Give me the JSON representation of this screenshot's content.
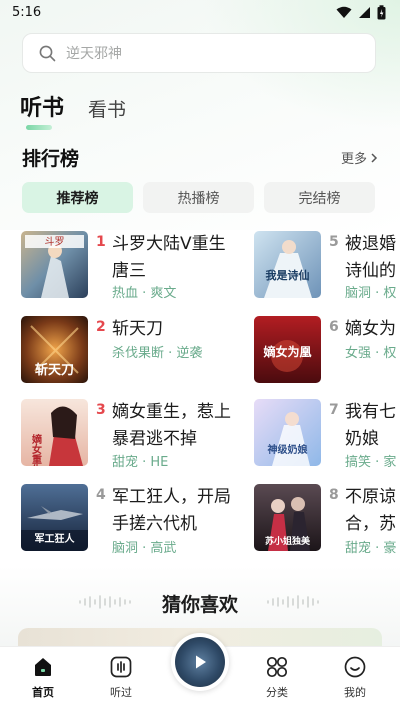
{
  "status_bar": {
    "time": "5:16"
  },
  "search": {
    "placeholder": "逆天邪神"
  },
  "top_tabs": [
    {
      "label": "听书",
      "active": true
    },
    {
      "label": "看书",
      "active": false
    }
  ],
  "ranking": {
    "title": "排行榜",
    "more_label": "更多",
    "tabs": [
      {
        "label": "推荐榜",
        "active": true
      },
      {
        "label": "热播榜",
        "active": false
      },
      {
        "label": "完结榜",
        "active": false
      }
    ],
    "books": [
      {
        "rank": "1",
        "title": "斗罗大陆V重生唐三",
        "tags": "热血 · 爽文",
        "cover_text": "斗罗"
      },
      {
        "rank": "2",
        "title": "斩天刀",
        "tags": "杀伐果断 · 逆袭",
        "cover_text": "斩天刀"
      },
      {
        "rank": "3",
        "title": "嫡女重生，惹上暴君逃不掉",
        "tags": "甜宠 · HE",
        "cover_text": "嫡女重生"
      },
      {
        "rank": "4",
        "title": "军工狂人，开局手搓六代机",
        "tags": "脑洞 · 高武",
        "cover_text": "军工狂人"
      },
      {
        "rank": "5",
        "title": "被退婚",
        "title_line2": "诗仙的",
        "tags": "脑洞 · 权",
        "cover_text": "我是诗仙"
      },
      {
        "rank": "6",
        "title": "嫡女为",
        "tags": "女强 · 权",
        "cover_text": "嫡女为凰"
      },
      {
        "rank": "7",
        "title": "我有七",
        "title_line2": "奶娘",
        "tags": "搞笑 · 家",
        "cover_text": "神级奶娘"
      },
      {
        "rank": "8",
        "title": "不原谅",
        "title_line2": "合，苏",
        "tags": "甜宠 · 豪",
        "cover_text": "苏小姐独美"
      }
    ]
  },
  "guess": {
    "title": "猜你喜欢"
  },
  "bottom_nav": [
    {
      "label": "首页",
      "icon": "home-icon",
      "active": true
    },
    {
      "label": "听过",
      "icon": "history-icon",
      "active": false
    },
    {
      "label": "分类",
      "icon": "category-icon",
      "active": false
    },
    {
      "label": "我的",
      "icon": "profile-icon",
      "active": false
    }
  ],
  "colors": {
    "accent": "#7ad6a6",
    "tag": "#6aab8c",
    "rank_top": "#e5484d",
    "rank_other": "#9a9a9a"
  }
}
